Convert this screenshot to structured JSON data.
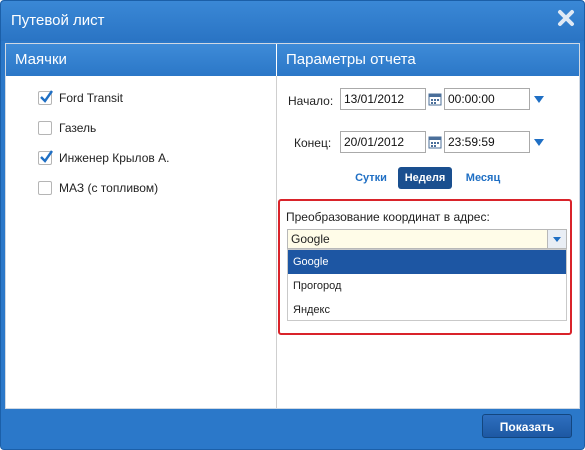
{
  "window": {
    "title": "Путевой лист"
  },
  "left": {
    "header": "Маячки",
    "items": [
      {
        "label": "Ford Transit",
        "checked": true
      },
      {
        "label": "Газель",
        "checked": false
      },
      {
        "label": "Инженер Крылов А.",
        "checked": true
      },
      {
        "label": "МАЗ (с топливом)",
        "checked": false
      }
    ]
  },
  "right": {
    "header": "Параметры отчета",
    "start": {
      "label": "Начало:",
      "date": "13/01/2012",
      "time": "00:00:00"
    },
    "end": {
      "label": "Конец:",
      "date": "20/01/2012",
      "time": "23:59:59"
    },
    "periods": {
      "day": "Сутки",
      "week": "Неделя",
      "month": "Месяц",
      "active": "week"
    },
    "coords": {
      "label": "Преобразование координат в адрес:",
      "selected": "Google",
      "options": [
        "Google",
        "Прогород",
        "Яндекс"
      ]
    }
  },
  "footer": {
    "show_button": "Показать"
  },
  "colors": {
    "accent": "#2b78c9",
    "highlight": "#d9232a",
    "check": "#1f6fc4"
  },
  "icons": {
    "close": "close-icon",
    "calendar": "calendar-icon",
    "dropdown": "chevron-down-icon",
    "check": "check-icon"
  }
}
